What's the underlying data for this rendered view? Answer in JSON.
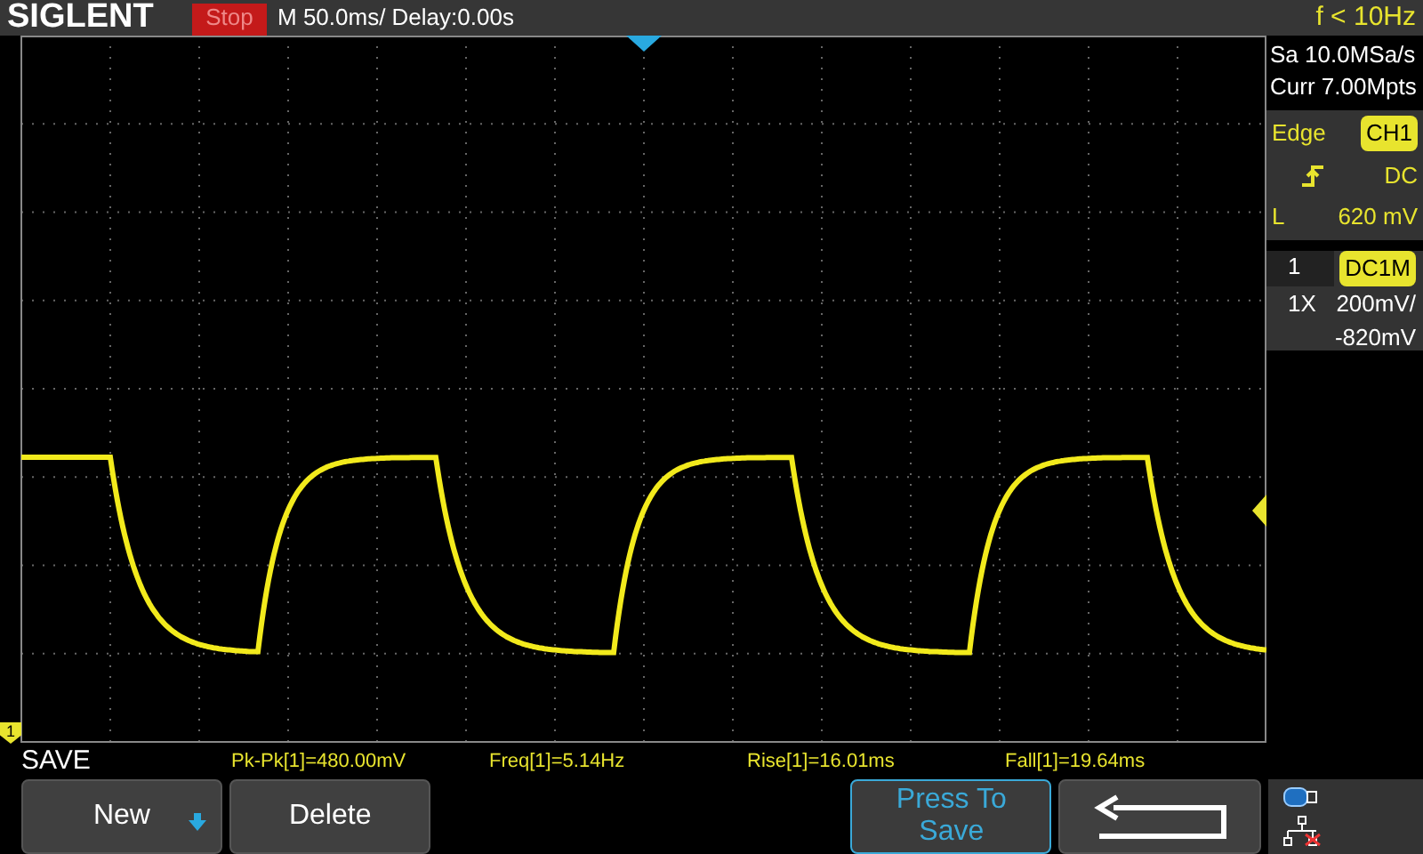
{
  "header": {
    "brand": "SIGLENT",
    "run_state": "Stop",
    "timebase": "M 50.0ms/ Delay:0.00s",
    "trigger_frequency": "f < 10Hz"
  },
  "acquisition": {
    "sample_rate": "Sa 10.0MSa/s",
    "memory_depth": "Curr 7.00Mpts"
  },
  "trigger": {
    "type": "Edge",
    "source": "CH1",
    "slope_rising": true,
    "coupling": "DC",
    "level_label": "L",
    "level_value": "620 mV"
  },
  "channel": {
    "number": "1",
    "coupling": "DC1M",
    "probe": "1X",
    "scale": "200mV/",
    "offset": "-820mV"
  },
  "channel_marker": "1",
  "menu_title": "SAVE",
  "measurements": [
    "Pk-Pk[1]=480.00mV",
    "Freq[1]=5.14Hz",
    "Rise[1]=16.01ms",
    "Fall[1]=19.64ms"
  ],
  "softkeys": [
    {
      "kind": "dropdown",
      "label": "New",
      "active": false
    },
    {
      "kind": "plain",
      "label": "Delete",
      "active": false
    },
    {
      "kind": "spacer"
    },
    {
      "kind": "plain",
      "label": "Press To Save",
      "active": true
    },
    {
      "kind": "back",
      "active": false
    }
  ]
}
